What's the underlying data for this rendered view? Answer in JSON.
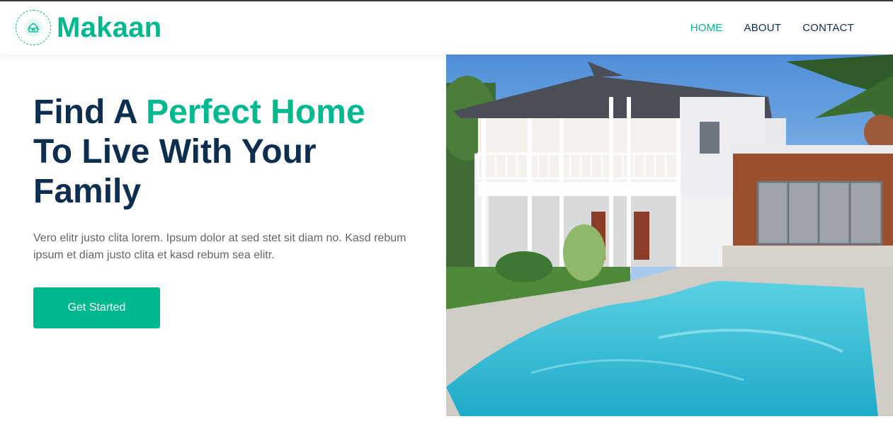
{
  "brand": {
    "name": "Makaan",
    "icon": "handshake-house-icon",
    "color": "#00B98E"
  },
  "nav": {
    "items": [
      {
        "label": "HOME",
        "active": true
      },
      {
        "label": "ABOUT",
        "active": false
      },
      {
        "label": "CONTACT",
        "active": false
      }
    ]
  },
  "hero": {
    "title_part1": "Find A ",
    "title_accent": "Perfect Home",
    "title_part2": "To Live With Your Family",
    "description": "Vero elitr justo clita lorem. Ipsum dolor at sed stet sit diam no. Kasd rebum ipsum et diam justo clita et kasd rebum sea elitr.",
    "cta_label": "Get Started",
    "image": "house-with-pool-photo"
  },
  "colors": {
    "primary": "#00B98E",
    "dark": "#0E2E50",
    "text": "#666565"
  }
}
